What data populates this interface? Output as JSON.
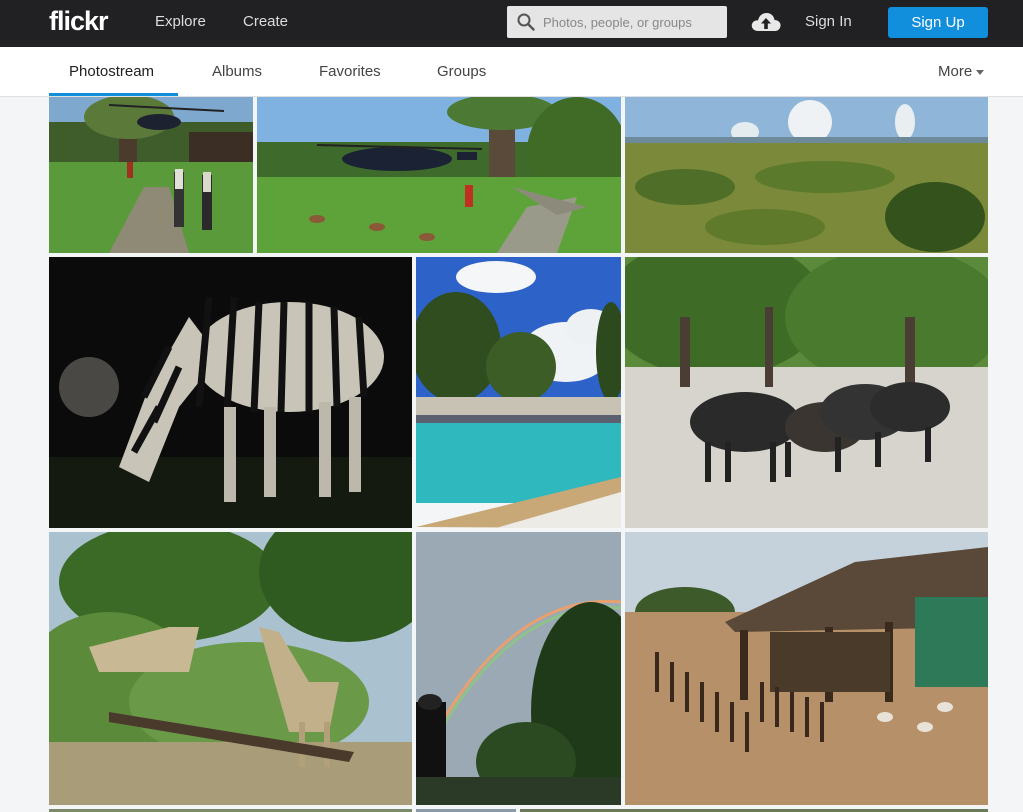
{
  "header": {
    "logo": "flickr",
    "nav": [
      "Explore",
      "Create"
    ],
    "search_placeholder": "Photos, people, or groups",
    "sign_in": "Sign In",
    "sign_up": "Sign Up"
  },
  "subnav": {
    "tabs": [
      "Photostream",
      "Albums",
      "Favorites",
      "Groups"
    ],
    "active_tab": "Photostream",
    "more": "More"
  },
  "colors": {
    "topbar": "#212124",
    "accent": "#128fdc"
  }
}
